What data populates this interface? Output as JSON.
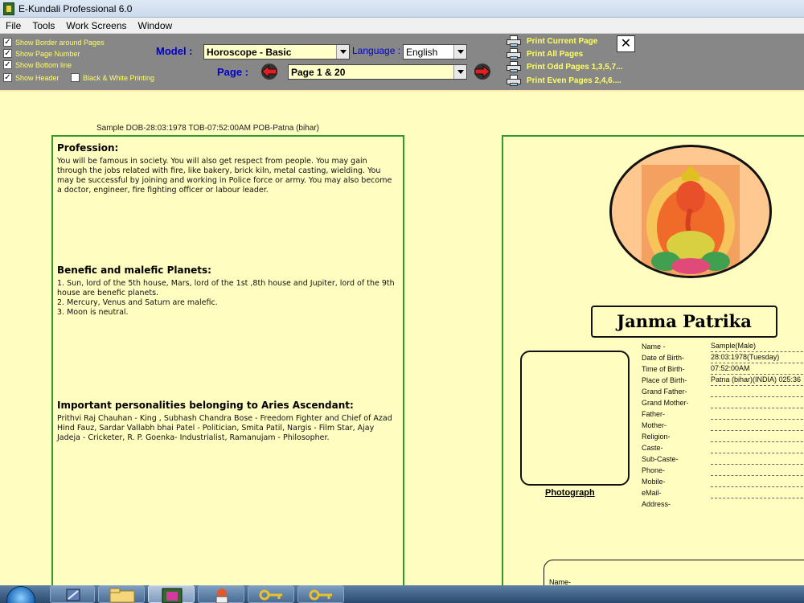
{
  "window": {
    "title": "E-Kundali Professional 6.0"
  },
  "menu": [
    "File",
    "Tools",
    "Work Screens",
    "Window"
  ],
  "toolbar": {
    "options": [
      {
        "label": "Show Border around Pages",
        "checked": true
      },
      {
        "label": "Show Page Number",
        "checked": true
      },
      {
        "label": "Show Bottom line",
        "checked": true
      },
      {
        "label": "Show Header",
        "checked": true
      }
    ],
    "bw_printing": {
      "label": "Black & White Printing",
      "checked": false
    },
    "model_label": "Model :",
    "model_value": "Horoscope - Basic",
    "language_label": "Language :",
    "language_value": "English",
    "page_label": "Page :",
    "page_value": "Page 1 & 20",
    "print_options": [
      "Print Current Page",
      "Print All Pages",
      "Print Odd Pages 1,3,5,7...",
      "Print Even Pages 2,4,6...."
    ],
    "close_symbol": "✕"
  },
  "page": {
    "sample_line": "Sample DOB-28:03:1978 TOB-07:52:00AM POB-Patna (bihar)",
    "sections": [
      {
        "title": "Profession:",
        "lines": [
          "You will be famous in society. You will also get respect from people. You may gain through the jobs related with fire, like bakery, brick kiln, metal casting, wielding. You may be successful by joining and working in Police force or army. You may also become a doctor, engineer, fire fighting officer or labour leader."
        ]
      },
      {
        "title": "Benefic and malefic Planets:",
        "lines": [
          "1. Sun, lord of the 5th house, Mars, lord of the 1st ,8th house and Jupiter, lord of the 9th house are benefic planets.",
          "2. Mercury, Venus and Saturn are malefic.",
          "3. Moon is neutral."
        ]
      },
      {
        "title": "Important personalities belonging to Aries Ascendant:",
        "lines": [
          "Prithvi Raj Chauhan - King , Subhash Chandra Bose - Freedom Fighter and Chief of Azad Hind Fauz, Sardar Vallabh bhai Patel - Politician,  Smita Patil, Nargis - Film Star, Ajay Jadeja - Cricketer, R. P. Goenka- Industrialist, Ramanujam - Philosopher."
        ]
      }
    ],
    "cover": {
      "heading": "Janma Patrika",
      "photo_label": "Photograph",
      "fields": [
        {
          "label": "Name -",
          "value": "Sample(Male)"
        },
        {
          "label": "Date of Birth-",
          "value": "28:03:1978(Tuesday)"
        },
        {
          "label": "Time of Birth-",
          "value": "07:52:00AM"
        },
        {
          "label": "Place of Birth-",
          "value": "Patna (bihar)(INDIA) 025:36"
        },
        {
          "label": "Grand Father-",
          "value": ""
        },
        {
          "label": "Grand Mother-",
          "value": ""
        },
        {
          "label": "Father-",
          "value": ""
        },
        {
          "label": "Mother-",
          "value": ""
        },
        {
          "label": "Religion-",
          "value": ""
        },
        {
          "label": "Caste-",
          "value": ""
        },
        {
          "label": "Sub-Caste-",
          "value": ""
        },
        {
          "label": "Phone-",
          "value": ""
        },
        {
          "label": "Mobile-",
          "value": ""
        },
        {
          "label": "eMail-",
          "value": ""
        },
        {
          "label": "Address-",
          "value": ""
        }
      ],
      "lower_name_label": "Name-"
    }
  },
  "colors": {
    "toolbar_bg": "#878787",
    "label_yellow": "#ffff66",
    "label_blue": "#0000cc",
    "page_bg": "#fffdc0",
    "panel_border": "#2c9a2c"
  }
}
